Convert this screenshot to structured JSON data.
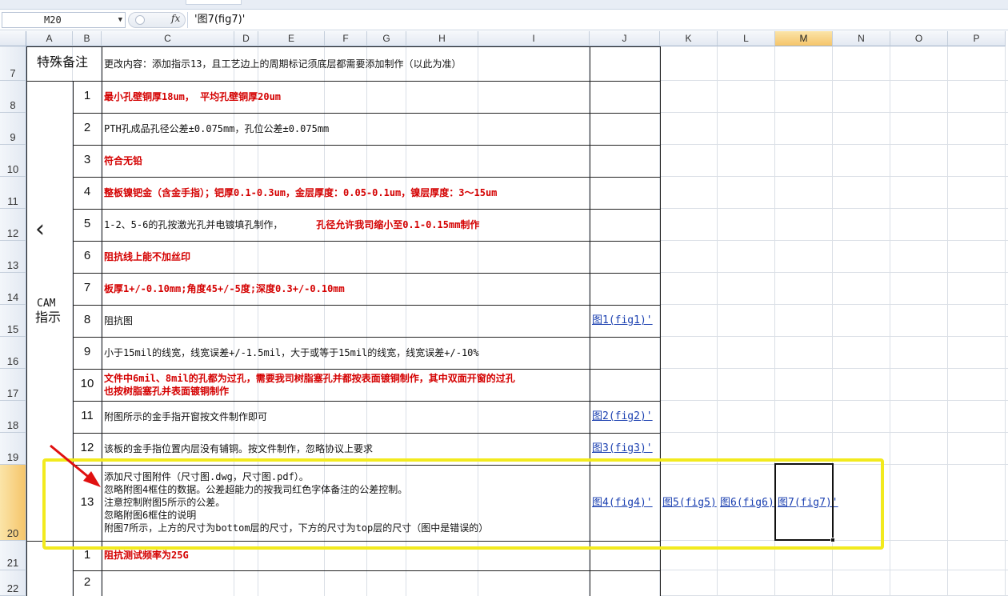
{
  "formula_bar": {
    "cell_ref": "M20",
    "formula": "'图7(fig7)'",
    "fx_label": "fx"
  },
  "columns": [
    "A",
    "B",
    "C",
    "D",
    "E",
    "F",
    "G",
    "H",
    "I",
    "J",
    "K",
    "L",
    "M",
    "N",
    "O",
    "P"
  ],
  "selected_column": "M",
  "rows": [
    "7",
    "8",
    "9",
    "10",
    "11",
    "12",
    "13",
    "14",
    "15",
    "16",
    "17",
    "18",
    "19",
    "20",
    "21",
    "22"
  ],
  "selected_row": "20",
  "section_labels": {
    "special_notes": "特殊备注",
    "cam_line1": "CAM",
    "cam_line2": "指示",
    "collapse_glyph": "‹"
  },
  "special_notes_text": "更改内容：添加指示13，且工艺边上的周期标记须底层都需要添加制作（以此为准）",
  "instructions": [
    {
      "no": "1",
      "text": "最小孔壁铜厚18um，  平均孔壁铜厚20um",
      "red": true,
      "link": ""
    },
    {
      "no": "2",
      "text": "PTH孔成品孔径公差±0.075mm，孔位公差±0.075mm",
      "red": false,
      "link": ""
    },
    {
      "no": "3",
      "text": "符合无铅",
      "red": true,
      "link": ""
    },
    {
      "no": "4",
      "text": "整板镍钯金（含金手指）；钯厚0.1-0.3um，金层厚度：0.05-0.1um，镍层厚度：3～15um",
      "red": true,
      "link": ""
    },
    {
      "no": "5",
      "text_black": "1-2、5-6的孔按激光孔并电镀填孔制作，",
      "text_red": "孔径允许我司缩小至0.1-0.15mm制作",
      "link": ""
    },
    {
      "no": "6",
      "text": "阻抗线上能不加丝印",
      "red": true,
      "link": ""
    },
    {
      "no": "7",
      "text": "板厚1+/-0.10mm;角度45+/-5度;深度0.3+/-0.10mm",
      "red": true,
      "link": ""
    },
    {
      "no": "8",
      "text": "阻抗图",
      "red": false,
      "link": "图1(fig1)'"
    },
    {
      "no": "9",
      "text": "小于15mil的线宽，线宽误差+/-1.5mil，大于或等于15mil的线宽，线宽误差+/-10%",
      "red": false,
      "link": ""
    },
    {
      "no": "10",
      "line1": "文件中6mil、8mil的孔都为过孔，需要我司树脂塞孔并都按表面镀铜制作，其中双面开窗的过孔",
      "line2": "也按树脂塞孔并表面镀铜制作",
      "red": true,
      "link": ""
    },
    {
      "no": "11",
      "text": "附图所示的金手指开窗按文件制作即可",
      "red": false,
      "link": "图2(fig2)'"
    },
    {
      "no": "12",
      "text": "该板的金手指位置内层没有铺铜。按文件制作，忽略协议上要求",
      "red": false,
      "link": "图3(fig3)'"
    },
    {
      "no": "13",
      "lines": [
        "添加尺寸图附件（尺寸图.dwg，尺寸图.pdf）。",
        "忽略附图4框住的数据。公差超能力的按我司红色字体备注的公差控制。",
        "注意控制附图5所示的公差。",
        "忽略附图6框住的说明",
        "附图7所示，上方的尺寸为bottom层的尺寸，下方的尺寸为top层的尺寸（图中是错误的）"
      ],
      "red": false,
      "links": [
        "图4(fig4)'",
        "图5(fig5)",
        "图6(fig6)",
        "图7(fig7)'"
      ]
    }
  ],
  "next_section": [
    {
      "no": "1",
      "text": "阻抗测试频率为25G",
      "red": true
    },
    {
      "no": "2",
      "text": "",
      "red": false
    }
  ],
  "colors": {
    "highlight_box": "#f2ea1e",
    "arrow": "#e01010",
    "selection": "#f5c56a",
    "link": "#1a3fb0",
    "red_text": "#d40000"
  }
}
